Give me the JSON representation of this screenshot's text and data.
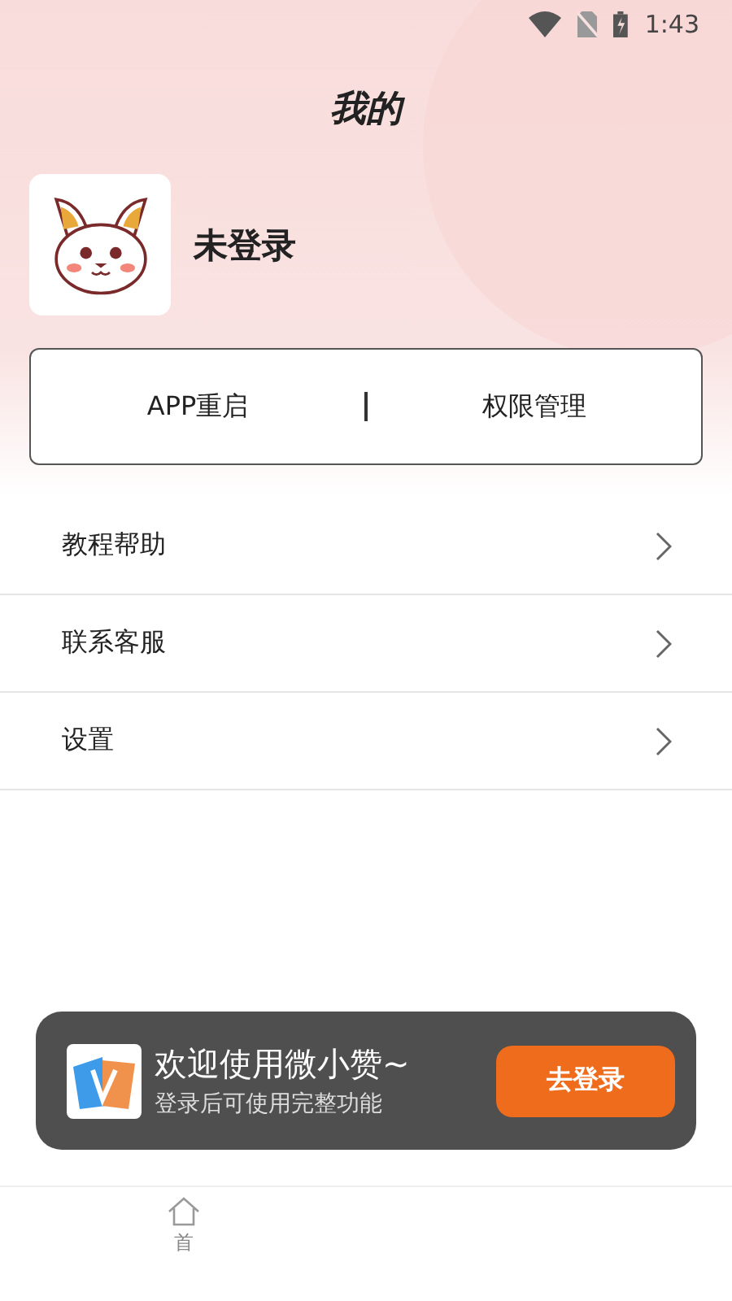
{
  "status_bar": {
    "time": "1:43"
  },
  "header": {
    "title": "我的"
  },
  "profile": {
    "name": "未登录"
  },
  "quick_actions": [
    "APP重启",
    "权限管理"
  ],
  "menu": [
    {
      "label": "教程帮助"
    },
    {
      "label": "联系客服"
    },
    {
      "label": "设置"
    }
  ],
  "login_banner": {
    "title": "欢迎使用微小赞~",
    "subtitle": "登录后可使用完整功能",
    "button": "去登录"
  },
  "bottom_nav": [
    {
      "label": "首"
    }
  ]
}
